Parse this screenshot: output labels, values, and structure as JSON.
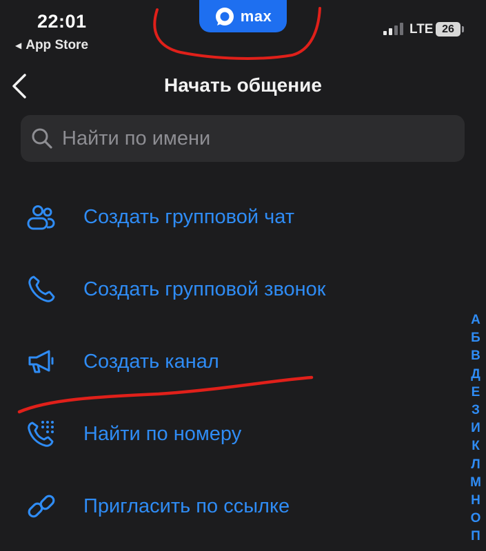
{
  "status_bar": {
    "time": "22:01",
    "back_label": "App Store",
    "app_name": "max",
    "network": "LTE",
    "battery": "26"
  },
  "header": {
    "title": "Начать общение"
  },
  "search": {
    "placeholder": "Найти по имени"
  },
  "actions": [
    {
      "label": "Создать групповой чат",
      "icon": "group-icon"
    },
    {
      "label": "Создать групповой звонок",
      "icon": "phone-icon"
    },
    {
      "label": "Создать канал",
      "icon": "megaphone-icon"
    },
    {
      "label": "Найти по номеру",
      "icon": "dialpad-phone-icon"
    },
    {
      "label": "Пригласить по ссылке",
      "icon": "link-icon"
    }
  ],
  "alphabet_index": [
    "А",
    "Б",
    "В",
    "Д",
    "Е",
    "З",
    "И",
    "К",
    "Л",
    "М",
    "Н",
    "О",
    "П"
  ],
  "colors": {
    "background": "#1c1c1e",
    "accent": "#2f8cf5",
    "brand": "#1e6ff0",
    "annotation": "#e0201a"
  }
}
